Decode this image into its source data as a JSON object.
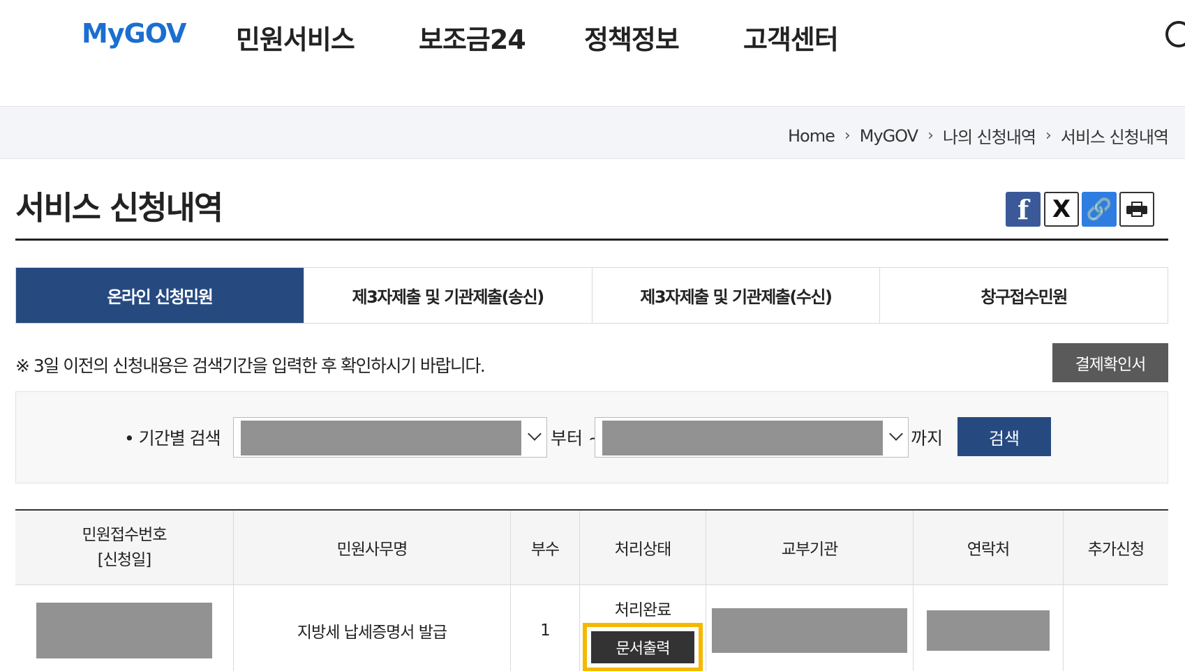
{
  "nav": {
    "brand": "MyGOV",
    "items": [
      "민원서비스",
      "보조금24",
      "정책정보",
      "고객센터"
    ]
  },
  "breadcrumb": [
    "Home",
    "MyGOV",
    "나의 신청내역",
    "서비스 신청내역"
  ],
  "page": {
    "title": "서비스 신청내역",
    "share": {
      "facebook": "f",
      "x": "X",
      "link": "🔗"
    }
  },
  "tabs": [
    {
      "label": "온라인 신청민원",
      "active": true
    },
    {
      "label": "제3자제출 및 기관제출(송신)",
      "active": false
    },
    {
      "label": "제3자제출 및 기관제출(수신)",
      "active": false
    },
    {
      "label": "창구접수민원",
      "active": false
    }
  ],
  "notice": "※ 3일 이전의 신청내용은 검색기간을 입력한 후 확인하시기 바랍니다.",
  "payment_button": "결제확인서",
  "search": {
    "label": "• 기간별 검색",
    "from_suffix": "부터 ~",
    "to_suffix": "까지",
    "button": "검색"
  },
  "table": {
    "headers": [
      "민원접수번호\n[신청일]",
      "민원사무명",
      "부수",
      "처리상태",
      "교부기관",
      "연락처",
      "추가신청"
    ],
    "rows": [
      {
        "service_name": "지방세 납세증명서 발급",
        "copies": "1",
        "status": "처리완료",
        "print_button": "문서출력"
      }
    ]
  },
  "colors": {
    "accent": "#264a80",
    "brand": "#1a6fd0",
    "highlight": "#f5b800"
  }
}
